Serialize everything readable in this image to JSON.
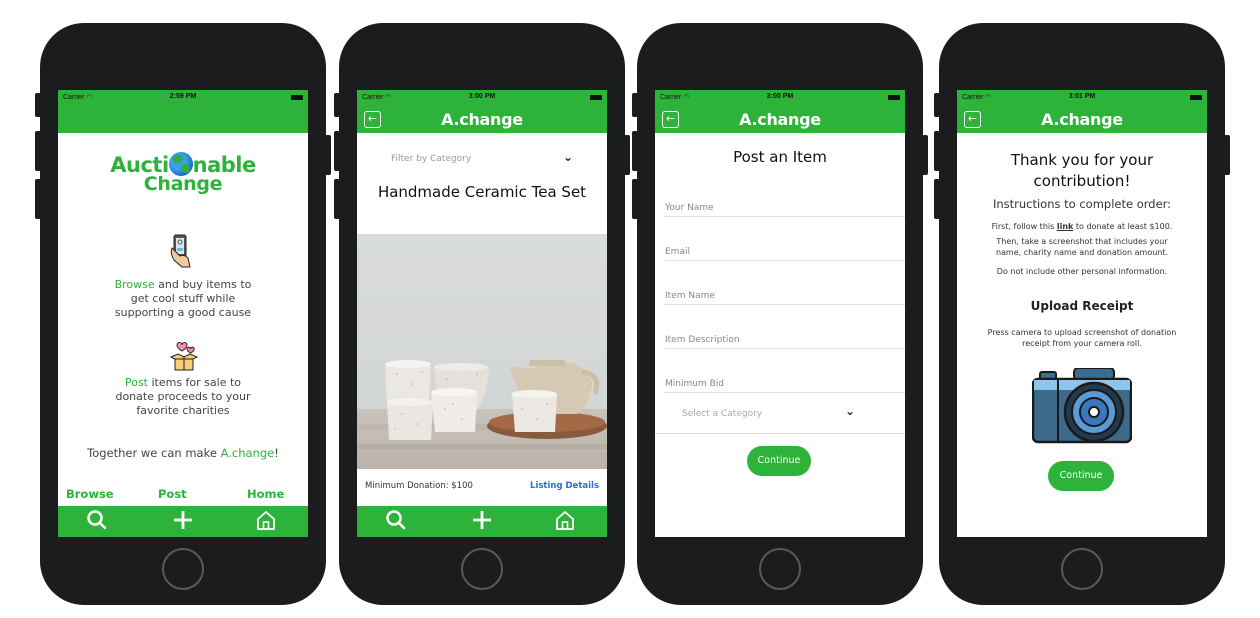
{
  "colors": {
    "brand_green": "#2db33a",
    "link_blue": "#2a6fdb",
    "phone_frame": "#1b1c1e"
  },
  "screens": [
    {
      "status": {
        "carrier": "Carrier",
        "time": "2:59 PM"
      },
      "logo": {
        "line1_left": "Aucti",
        "line1_right": "nable",
        "line2": "Change",
        "icon": "globe-icon"
      },
      "browse_blurb": {
        "icon": "phone-hand-icon",
        "highlight": "Browse",
        "rest": " and buy items to",
        "line2": "get cool stuff while",
        "line3": "supporting a good cause"
      },
      "post_blurb": {
        "icon": "gift-box-hearts-icon",
        "highlight": "Post",
        "rest": " items for sale to",
        "line2": "donate proceeds to your",
        "line3": "favorite charities"
      },
      "tagline": {
        "prefix": "Together we can make ",
        "highlight": "A.change",
        "suffix": "!"
      },
      "bottom_links": [
        "Browse",
        "Post",
        "Home"
      ],
      "tabbar": [
        "search-icon",
        "plus-icon",
        "home-icon"
      ]
    },
    {
      "status": {
        "carrier": "Carrier",
        "time": "3:00 PM"
      },
      "nav_title": "A.change",
      "filter_label": "Filter by Category",
      "item_title": "Handmade Ceramic Tea Set",
      "item_image": "ceramic tea set photo",
      "min_donation": "Minimum Donation: $100",
      "details_link": "Listing Details",
      "tabbar": [
        "search-icon",
        "plus-icon",
        "home-icon"
      ]
    },
    {
      "status": {
        "carrier": "Carrier",
        "time": "3:00 PM"
      },
      "nav_title": "A.change",
      "form_title": "Post an Item",
      "fields": [
        "Your Name",
        "Email",
        "Item Name",
        "Item Description",
        "Minimum Bid"
      ],
      "category_placeholder": "Select a Category",
      "continue_label": "Continue"
    },
    {
      "status": {
        "carrier": "Carrier",
        "time": "3:01 PM"
      },
      "nav_title": "A.change",
      "thanks_line1": "Thank you for your",
      "thanks_line2": "contribution!",
      "instructions_title": "Instructions to complete order:",
      "step1_prefix": "First, follow this ",
      "step1_link": "link",
      "step1_suffix": " to donate at least $100.",
      "step2_line1": "Then, take a screenshot that includes your",
      "step2_line2": "name, charity name and donation amount.",
      "note": "Do not include other personal information.",
      "upload_title": "Upload Receipt",
      "upload_help_line1": "Press camera to upload screenshot of donation",
      "upload_help_line2": "receipt from your camera roll.",
      "camera_icon": "camera-icon",
      "continue_label": "Continue"
    }
  ]
}
